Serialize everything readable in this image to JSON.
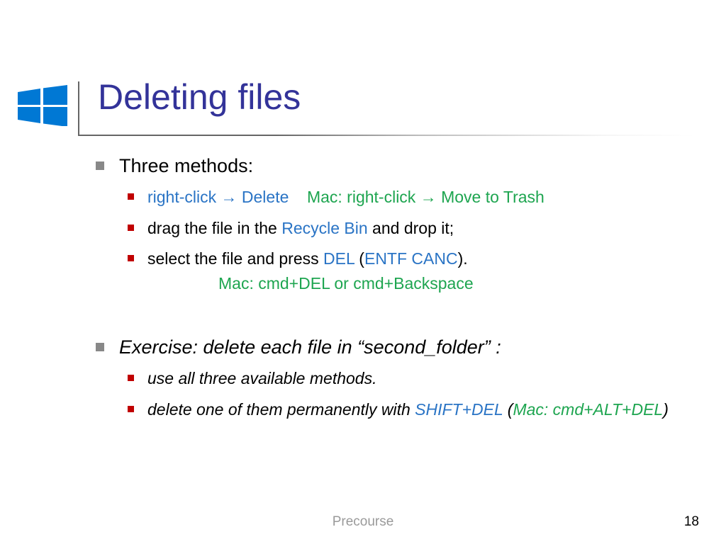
{
  "title": "Deleting files",
  "body": {
    "item1": {
      "label": "Three methods:",
      "sub1": {
        "a": "right-click ",
        "arrow1": "→",
        "b": " Delete",
        "gap": "    ",
        "mac": "Mac: right-click ",
        "arrow2": "→",
        "mac2": " Move to Trash"
      },
      "sub2": {
        "a": "drag the file in the ",
        "b": "Recycle Bin",
        "c": " and drop it;"
      },
      "sub3": {
        "a": "select the file and press ",
        "b": "DEL",
        "lp": " (",
        "c": "ENTF CANC",
        "rp": ").",
        "mac_line": "Mac: cmd+DEL or cmd+Backspace"
      }
    },
    "item2": {
      "label": "Exercise: delete each file in “second_folder” :",
      "sub1": "use all three available methods.",
      "sub2": {
        "a": "delete one of them permanently with ",
        "b": "SHIFT+DEL",
        "lp": " (",
        "c": "Mac: cmd+ALT+DEL",
        "rp": ")"
      }
    }
  },
  "footer": {
    "center": "Precourse",
    "page": "18"
  }
}
